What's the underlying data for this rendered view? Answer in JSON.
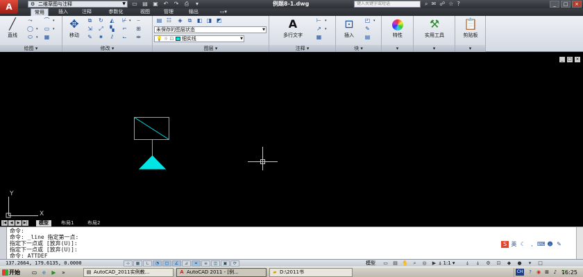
{
  "title_bar": {
    "app_logo": "A",
    "workspace": "二维草图与注释",
    "document_title": "例题8-1.dwg",
    "search_placeholder": "键入关键字或短语",
    "win_controls": [
      "_",
      "□",
      "×"
    ]
  },
  "tabs": [
    {
      "label": "常用",
      "active": true
    },
    {
      "label": "插入",
      "active": false
    },
    {
      "label": "注释",
      "active": false
    },
    {
      "label": "参数化",
      "active": false
    },
    {
      "label": "视图",
      "active": false
    },
    {
      "label": "管理",
      "active": false
    },
    {
      "label": "输出",
      "active": false
    }
  ],
  "ribbon": {
    "draw": {
      "title": "绘图",
      "line_label": "直线"
    },
    "modify": {
      "title": "修改",
      "move_label": "移动"
    },
    "layers": {
      "title": "图层",
      "layer_state": "未保存的图层状态",
      "current_layer": "细实线"
    },
    "annotation": {
      "title": "注释",
      "mtext_label": "多行文字"
    },
    "block": {
      "title": "块",
      "insert_label": "插入"
    },
    "properties": {
      "label": "特性"
    },
    "utilities": {
      "label": "实用工具"
    },
    "clipboard": {
      "label": "剪贴板"
    }
  },
  "drawing": {
    "geometry_color": "#00e5e5",
    "crosshair_color": "#cccccc",
    "ucs_x": "X",
    "ucs_y": "Y"
  },
  "layout_tabs": [
    {
      "label": "模型",
      "active": true
    },
    {
      "label": "布局1",
      "active": false
    },
    {
      "label": "布局2",
      "active": false
    }
  ],
  "command_history": [
    "命令:",
    "命令: _line 指定第一点:",
    "指定下一点或 [放弃(U)]:",
    "指定下一点或 [放弃(U)]:",
    "命令: ATTDEF"
  ],
  "status_bar": {
    "coordinates": "137.2664, 179.6135, 0.0000",
    "model_label": "模型",
    "annotation_scale": "1:1"
  },
  "taskbar": {
    "start_label": "开始",
    "tasks": [
      {
        "label": "AutoCAD_2011实例教...",
        "active": false
      },
      {
        "label": "AutoCAD 2011 - [例...",
        "active": true
      },
      {
        "label": "D:\\2011书",
        "active": false
      }
    ],
    "ime": "CH",
    "clock": "16:25"
  }
}
